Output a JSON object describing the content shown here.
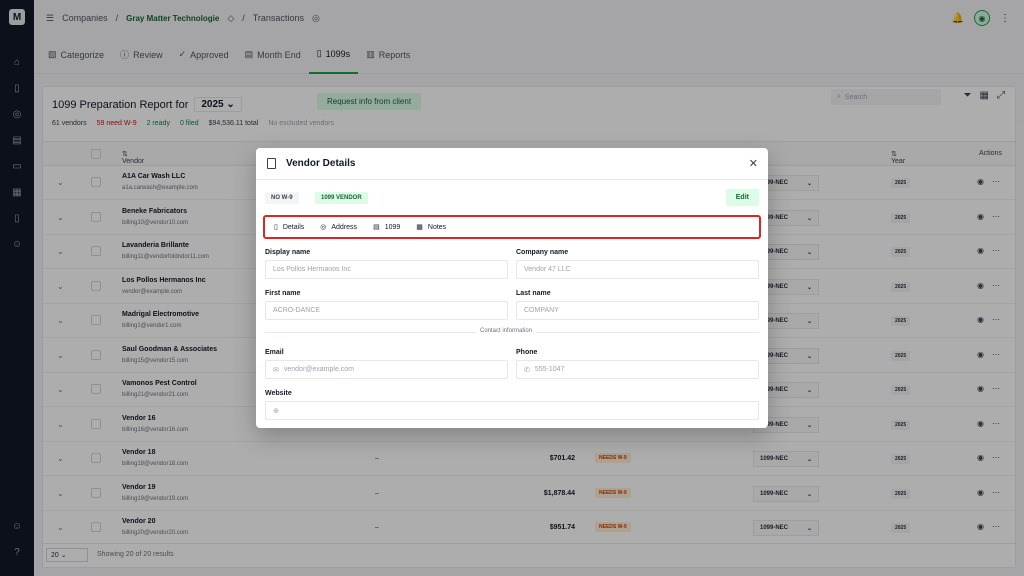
{
  "app": {
    "logo": "M"
  },
  "breadcrumb": {
    "companies": "Companies",
    "company": "Gray Matter Technologie",
    "section": "Transactions"
  },
  "tabs": [
    {
      "label": "Categorize",
      "icon": "categorize-icon"
    },
    {
      "label": "Review",
      "icon": "review-icon"
    },
    {
      "label": "Approved",
      "icon": "approved-icon"
    },
    {
      "label": "Month End",
      "icon": "month-end-icon"
    },
    {
      "label": "1099s",
      "icon": "form-icon"
    },
    {
      "label": "Reports",
      "icon": "reports-icon"
    }
  ],
  "report": {
    "title": "1099 Preparation Report for",
    "year": "2025",
    "request_btn": "Request info from client",
    "stats": {
      "vendors": "61 vendors",
      "need_w9": "59 need W-9",
      "ready": "2 ready",
      "filed": "0 filed",
      "total": "$94,536.11 total",
      "excluded": "No excluded vendors"
    },
    "search_placeholder": "Search",
    "columns": {
      "vendor": "Vendor",
      "year": "Year",
      "actions": "Actions"
    },
    "rows": [
      {
        "name": "A1A Car Wash LLC",
        "email": "a1a.carwash@example.com"
      },
      {
        "name": "Beneke Fabricators",
        "email": "billing10@vendor10.com"
      },
      {
        "name": "Lavanderia Brillante",
        "email": "billing11@vendorfoldndor11.com"
      },
      {
        "name": "Los Pollos Hermanos Inc",
        "email": "vendor@example.com"
      },
      {
        "name": "Madrigal Electromotive",
        "email": "billing1@vendor1.com"
      },
      {
        "name": "Saul Goodman & Associates",
        "email": "billing15@vendor15.com"
      },
      {
        "name": "Vamonos Pest Control",
        "email": "billing21@vendor21.com"
      },
      {
        "name": "Vendor 16",
        "email": "billing16@vendor16.com"
      },
      {
        "name": "Vendor 18",
        "email": "billing18@vendor18.com",
        "w9": "–",
        "amount": "$701.42",
        "status": "NEEDS W-9"
      },
      {
        "name": "Vendor 19",
        "email": "billing19@vendor19.com",
        "w9": "–",
        "amount": "$1,878.44",
        "status": "NEEDS W-9"
      },
      {
        "name": "Vendor 20",
        "email": "billing20@vendor20.com",
        "w9": "–",
        "amount": "$951.74",
        "status": "NEEDS W-9"
      }
    ],
    "form_value": "1099-NEC",
    "year_badge": "2025",
    "page_size": "20",
    "pager_text": "Showing 20 of 20 results"
  },
  "modal": {
    "title": "Vendor Details",
    "badge_w9": "NO W-9",
    "badge_1099": "1099 VENDOR",
    "edit": "Edit",
    "tabs": [
      "Details",
      "Address",
      "1099",
      "Notes"
    ],
    "fields": {
      "display_name_label": "Display name",
      "display_name_value": "Los Pollos Hermanos Inc",
      "company_name_label": "Company name",
      "company_name_value": "Vendor 47 LLC",
      "first_name_label": "First name",
      "first_name_value": "ACRO-DANCE",
      "last_name_label": "Last name",
      "last_name_value": "COMPANY",
      "contact_divider": "Contact information",
      "email_label": "Email",
      "email_value": "vendor@example.com",
      "phone_label": "Phone",
      "phone_value": "555-1047",
      "website_label": "Website",
      "website_value": ""
    }
  }
}
